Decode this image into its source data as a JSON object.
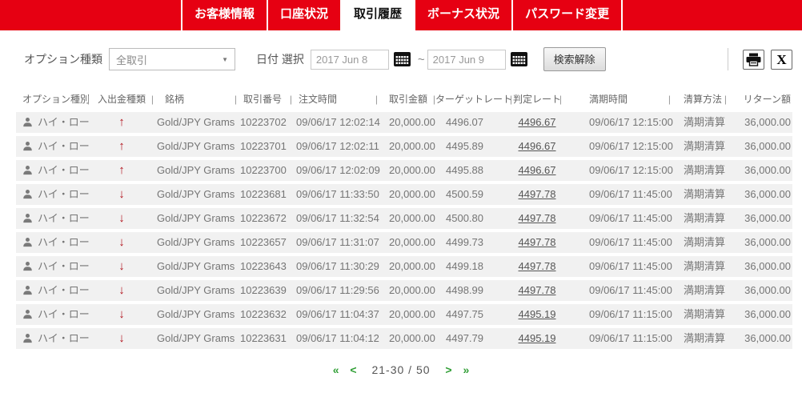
{
  "colors": {
    "nav_red": "#e60012",
    "arrow_red": "#b1121b",
    "pagination_green": "#2f9e34",
    "row_bg": "#f1f1f1"
  },
  "nav": {
    "tabs": [
      {
        "id": "customer-info",
        "label": "お客様情報",
        "active": false
      },
      {
        "id": "account-status",
        "label": "口座状況",
        "active": false
      },
      {
        "id": "trade-history",
        "label": "取引履歴",
        "active": true
      },
      {
        "id": "bonus-status",
        "label": "ボーナス状況",
        "active": false
      },
      {
        "id": "password-change",
        "label": "パスワード変更",
        "active": false
      }
    ]
  },
  "filters": {
    "option_type_label": "オプション種類",
    "option_type_value": "全取引",
    "date_label": "日付 選択",
    "date_from": "2017 Jun 8",
    "date_to": "2017 Jun 9",
    "range_separator": "~",
    "clear_button_label": "検索解除"
  },
  "toolbar": {
    "excel_glyph": "X"
  },
  "icons": {
    "up": "↑",
    "down": "↓",
    "caret_down": "▼"
  },
  "table": {
    "column_separator": "|",
    "headers": [
      "オプション種別",
      "入出金種類",
      "銘柄",
      "取引番号",
      "注文時間",
      "取引金額",
      "ターゲットレート",
      "判定レート",
      "満期時間",
      "清算方法",
      "リターン額"
    ],
    "rows": [
      {
        "option_type": "ハイ・ロー",
        "direction": "up",
        "symbol": "Gold/JPY Grams",
        "trade_no": "10223702",
        "order_time": "09/06/17 12:02:14",
        "amount": "20,000.00",
        "target_rate": "4496.07",
        "judge_rate": "4496.67",
        "expiry_time": "09/06/17 12:15:00",
        "settlement": "満期清算",
        "return_amount": "36,000.00"
      },
      {
        "option_type": "ハイ・ロー",
        "direction": "up",
        "symbol": "Gold/JPY Grams",
        "trade_no": "10223701",
        "order_time": "09/06/17 12:02:11",
        "amount": "20,000.00",
        "target_rate": "4495.89",
        "judge_rate": "4496.67",
        "expiry_time": "09/06/17 12:15:00",
        "settlement": "満期清算",
        "return_amount": "36,000.00"
      },
      {
        "option_type": "ハイ・ロー",
        "direction": "up",
        "symbol": "Gold/JPY Grams",
        "trade_no": "10223700",
        "order_time": "09/06/17 12:02:09",
        "amount": "20,000.00",
        "target_rate": "4495.88",
        "judge_rate": "4496.67",
        "expiry_time": "09/06/17 12:15:00",
        "settlement": "満期清算",
        "return_amount": "36,000.00"
      },
      {
        "option_type": "ハイ・ロー",
        "direction": "down",
        "symbol": "Gold/JPY Grams",
        "trade_no": "10223681",
        "order_time": "09/06/17 11:33:50",
        "amount": "20,000.00",
        "target_rate": "4500.59",
        "judge_rate": "4497.78",
        "expiry_time": "09/06/17 11:45:00",
        "settlement": "満期清算",
        "return_amount": "36,000.00"
      },
      {
        "option_type": "ハイ・ロー",
        "direction": "down",
        "symbol": "Gold/JPY Grams",
        "trade_no": "10223672",
        "order_time": "09/06/17 11:32:54",
        "amount": "20,000.00",
        "target_rate": "4500.80",
        "judge_rate": "4497.78",
        "expiry_time": "09/06/17 11:45:00",
        "settlement": "満期清算",
        "return_amount": "36,000.00"
      },
      {
        "option_type": "ハイ・ロー",
        "direction": "down",
        "symbol": "Gold/JPY Grams",
        "trade_no": "10223657",
        "order_time": "09/06/17 11:31:07",
        "amount": "20,000.00",
        "target_rate": "4499.73",
        "judge_rate": "4497.78",
        "expiry_time": "09/06/17 11:45:00",
        "settlement": "満期清算",
        "return_amount": "36,000.00"
      },
      {
        "option_type": "ハイ・ロー",
        "direction": "down",
        "symbol": "Gold/JPY Grams",
        "trade_no": "10223643",
        "order_time": "09/06/17 11:30:29",
        "amount": "20,000.00",
        "target_rate": "4499.18",
        "judge_rate": "4497.78",
        "expiry_time": "09/06/17 11:45:00",
        "settlement": "満期清算",
        "return_amount": "36,000.00"
      },
      {
        "option_type": "ハイ・ロー",
        "direction": "down",
        "symbol": "Gold/JPY Grams",
        "trade_no": "10223639",
        "order_time": "09/06/17 11:29:56",
        "amount": "20,000.00",
        "target_rate": "4498.99",
        "judge_rate": "4497.78",
        "expiry_time": "09/06/17 11:45:00",
        "settlement": "満期清算",
        "return_amount": "36,000.00"
      },
      {
        "option_type": "ハイ・ロー",
        "direction": "down",
        "symbol": "Gold/JPY Grams",
        "trade_no": "10223632",
        "order_time": "09/06/17 11:04:37",
        "amount": "20,000.00",
        "target_rate": "4497.75",
        "judge_rate": "4495.19",
        "expiry_time": "09/06/17 11:15:00",
        "settlement": "満期清算",
        "return_amount": "36,000.00"
      },
      {
        "option_type": "ハイ・ロー",
        "direction": "down",
        "symbol": "Gold/JPY Grams",
        "trade_no": "10223631",
        "order_time": "09/06/17 11:04:12",
        "amount": "20,000.00",
        "target_rate": "4497.79",
        "judge_rate": "4495.19",
        "expiry_time": "09/06/17 11:15:00",
        "settlement": "満期清算",
        "return_amount": "36,000.00"
      }
    ]
  },
  "pagination": {
    "first": "«",
    "prev": "<",
    "range": "21-30 / 50",
    "next": ">",
    "last": "»"
  }
}
